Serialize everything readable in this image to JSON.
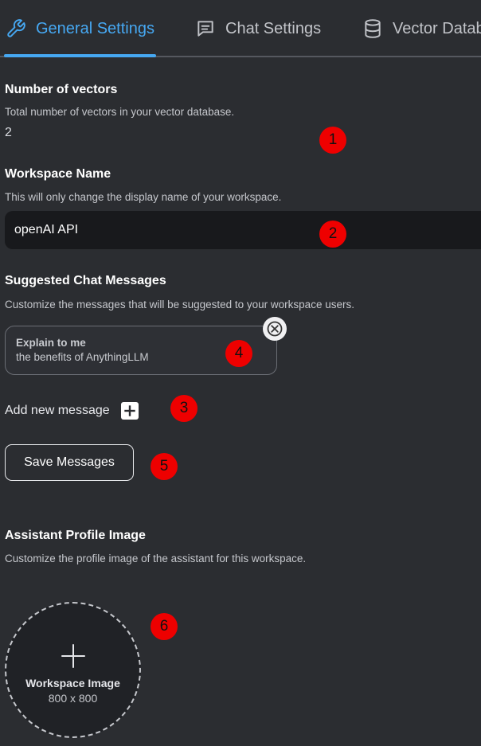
{
  "tabs": [
    {
      "label": "General Settings",
      "icon": "wrench-icon",
      "active": true
    },
    {
      "label": "Chat Settings",
      "icon": "chat-bubble-icon",
      "active": false
    },
    {
      "label": "Vector Datab",
      "icon": "database-icon",
      "active": false
    }
  ],
  "vectors": {
    "title": "Number of vectors",
    "description": "Total number of vectors in your vector database.",
    "count": "2"
  },
  "workspace_name": {
    "title": "Workspace Name",
    "description": "This will only change the display name of your workspace.",
    "value": "openAI API"
  },
  "suggested": {
    "title": "Suggested Chat Messages",
    "description": "Customize the messages that will be suggested to your workspace users.",
    "messages": [
      {
        "heading": "Explain to me",
        "message": "the benefits of AnythingLLM"
      }
    ],
    "add_label": "Add new message",
    "save_label": "Save Messages"
  },
  "profile_image": {
    "title": "Assistant Profile Image",
    "description": "Customize the profile image of the assistant for this workspace.",
    "upload_label": "Workspace Image",
    "upload_size": "800 x 800"
  },
  "markers": [
    "1",
    "2",
    "3",
    "4",
    "5",
    "6"
  ],
  "colors": {
    "accent": "#46a8f2",
    "background": "#2b2d31",
    "input_background": "#18191c",
    "marker": "#ee0000"
  }
}
